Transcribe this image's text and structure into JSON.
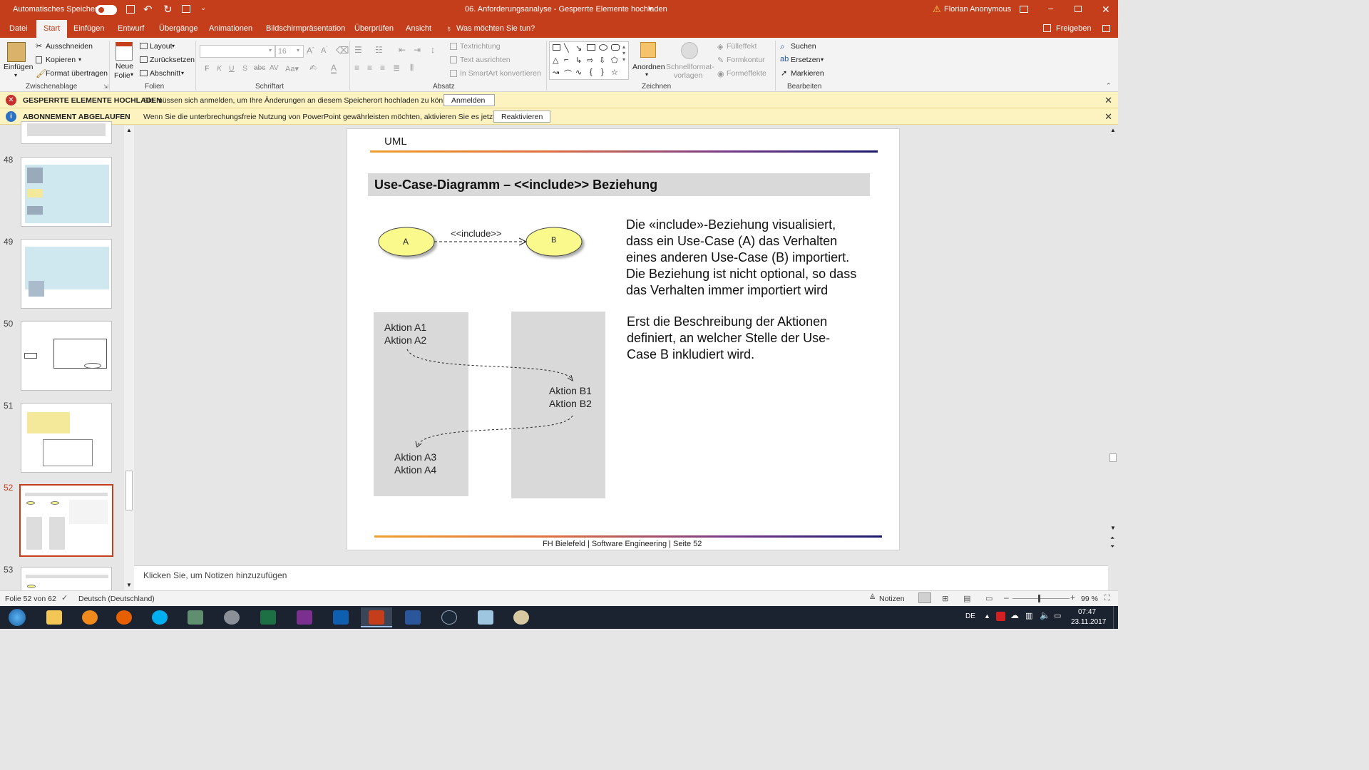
{
  "titlebar": {
    "autosave_label": "Automatisches Speichern",
    "autosave_state": "Aus",
    "document_title": "06. Anforderungsanalyse  -  Gesperrte Elemente hochladen",
    "user_name": "Florian Anonymous"
  },
  "tabs": {
    "datei": "Datei",
    "start": "Start",
    "einfuegen": "Einfügen",
    "entwurf": "Entwurf",
    "uebergaenge": "Übergänge",
    "animationen": "Animationen",
    "bildschirm": "Bildschirmpräsentation",
    "ueberpruefen": "Überprüfen",
    "ansicht": "Ansicht",
    "tell_me": "Was möchten Sie tun?",
    "share": "Freigeben"
  },
  "ribbon": {
    "clipboard": {
      "paste": "Einfügen",
      "cut": "Ausschneiden",
      "copy": "Kopieren",
      "format_painter": "Format übertragen",
      "label": "Zwischenablage"
    },
    "slides": {
      "new_slide_1": "Neue",
      "new_slide_2": "Folie",
      "layout": "Layout",
      "reset": "Zurücksetzen",
      "section": "Abschnitt",
      "label": "Folien"
    },
    "font": {
      "font_size": "16",
      "bold": "F",
      "italic": "K",
      "underline": "U",
      "strike": "S",
      "label": "Schriftart"
    },
    "paragraph": {
      "text_direction": "Textrichtung",
      "align_text": "Text ausrichten",
      "smartart": "In SmartArt konvertieren",
      "label": "Absatz"
    },
    "drawing": {
      "arrange": "Anordnen",
      "quick_styles_1": "Schnellformat-",
      "quick_styles_2": "vorlagen",
      "fill": "Fülleffekt",
      "outline": "Formkontur",
      "effects": "Formeffekte",
      "label": "Zeichnen"
    },
    "editing": {
      "find": "Suchen",
      "replace": "Ersetzen",
      "select": "Markieren",
      "label": "Bearbeiten"
    }
  },
  "infobars": [
    {
      "title": "GESPERRTE ELEMENTE HOCHLADEN",
      "message": "Sie müssen sich anmelden, um Ihre Änderungen an diesem Speicherort hochladen zu können.",
      "button": "Anmelden"
    },
    {
      "title": "ABONNEMENT ABGELAUFEN",
      "message": "Wenn Sie die unterbrechungsfreie Nutzung von PowerPoint gewährleisten möchten, aktivieren Sie es jetzt neu.",
      "button": "Reaktivieren"
    }
  ],
  "thumbnails": {
    "numbers": [
      "48",
      "49",
      "50",
      "51",
      "52",
      "53"
    ],
    "selected": "52"
  },
  "slide": {
    "header": "UML",
    "title": "Use-Case-Diagramm – <<include>> Beziehung",
    "usecase_a": "A",
    "usecase_b": "B",
    "include_label": "<<include>>",
    "text1_lines": [
      "Die «include»-Beziehung visualisiert,",
      "dass ein Use-Case (A) das Verhalten",
      "eines anderen Use-Case (B) importiert.",
      "Die Beziehung ist nicht optional, so dass",
      "das Verhalten immer importiert wird"
    ],
    "text2_lines": [
      "Erst die Beschreibung der Aktionen",
      "definiert, an welcher Stelle der Use-",
      "Case B inkludiert wird."
    ],
    "actions_a1": "Aktion A1",
    "actions_a2": "Aktion A2",
    "actions_b1": "Aktion B1",
    "actions_b2": "Aktion B2",
    "actions_a3": "Aktion A3",
    "actions_a4": "Aktion A4",
    "footer": "FH Bielefeld | Software Engineering | Seite 52"
  },
  "notes_placeholder": "Klicken Sie, um Notizen hinzuzufügen",
  "statusbar": {
    "slide_count": "Folie 52 von 62",
    "language": "Deutsch (Deutschland)",
    "notes": "Notizen",
    "zoom": "99 %"
  },
  "taskbar": {
    "lang": "DE",
    "time": "07:47",
    "date": "23.11.2017"
  },
  "colors": {
    "accent": "#c43e1c",
    "infobar": "#fcf3c0",
    "usecase_fill": "#fafa8c",
    "gradient_left": "#f0a030",
    "gradient_right": "#1a1a6e"
  }
}
